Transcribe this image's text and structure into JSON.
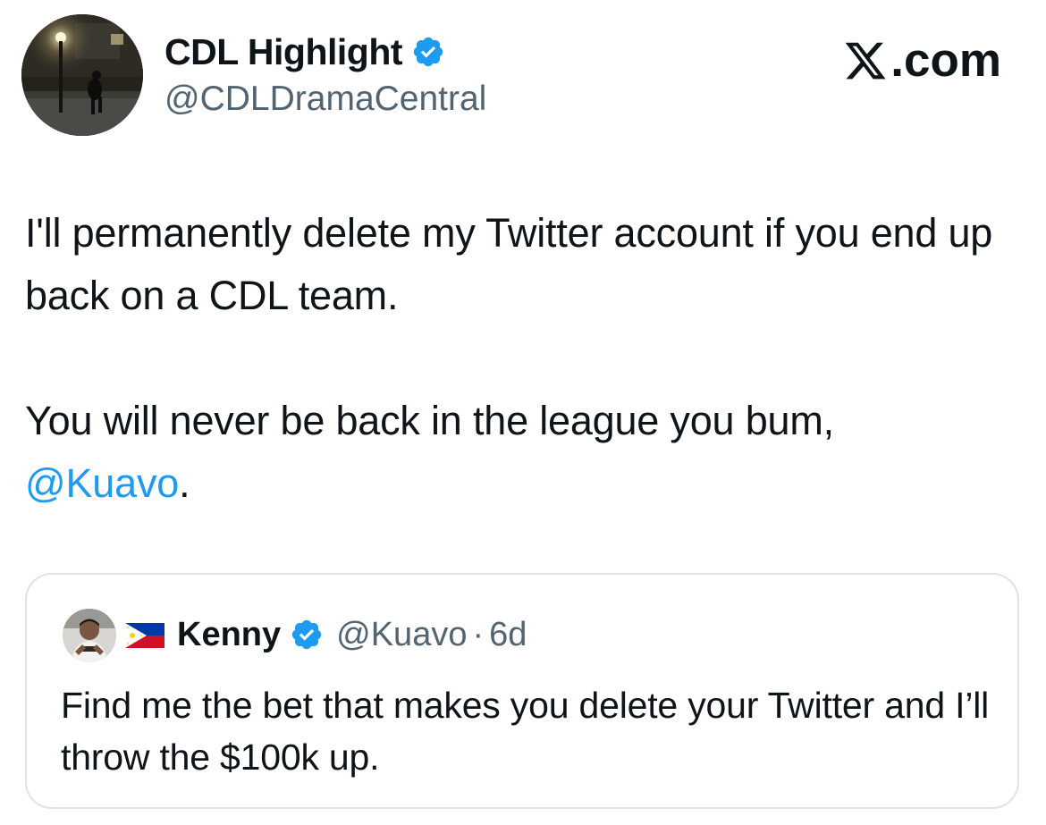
{
  "tweet": {
    "author": {
      "display_name": "CDL Highlight",
      "handle": "@CDLDramaCentral",
      "verified": true
    },
    "brand": {
      "logo_icon": "x-logo-icon",
      "label": ".com"
    },
    "text_line_1": "I'll permanently delete my Twitter account if you end up back on a CDL team.",
    "text_line_2_prefix": "You will never be back in the league you bum,",
    "mention": "@Kuavo",
    "text_line_2_suffix": "."
  },
  "quoted_tweet": {
    "author": {
      "flag_icon": "philippines-flag-icon",
      "display_name": "Kenny",
      "handle": "@Kuavo",
      "verified": true
    },
    "separator": "·",
    "time": "6d",
    "text": "Find me the bet that makes you delete your Twitter and I’ll throw the $100k up."
  },
  "colors": {
    "text": "#0f1419",
    "secondary": "#536471",
    "link": "#1d9bf0",
    "verified_badge": "#1d9bf0",
    "border": "#dfe3e6"
  }
}
